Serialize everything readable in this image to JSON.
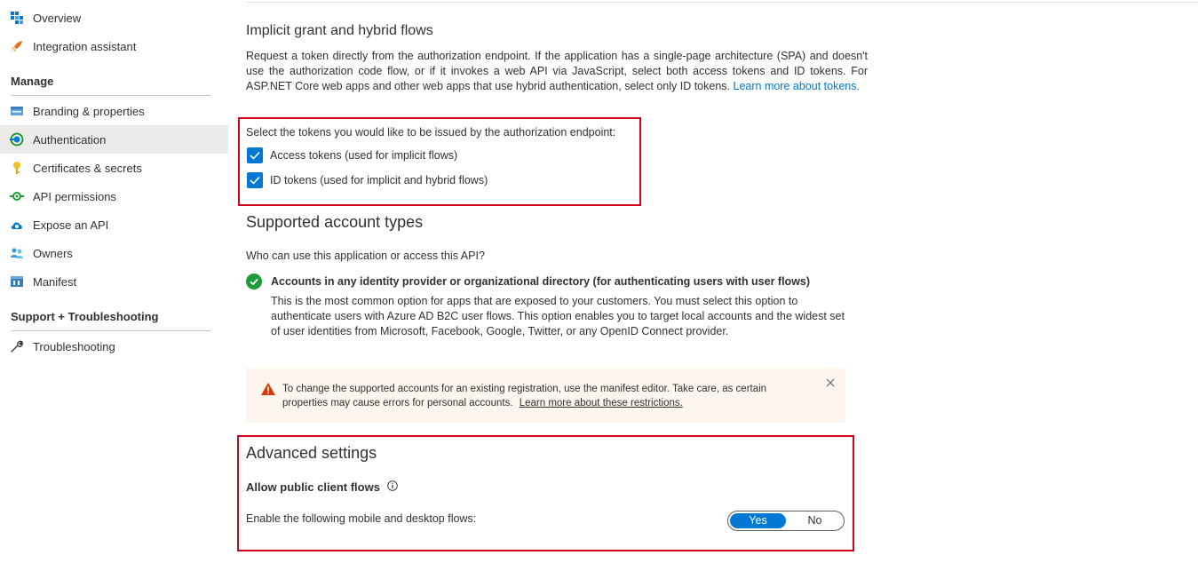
{
  "sidebar": {
    "top_items": [
      {
        "label": "Overview",
        "icon": "overview-grid-icon"
      },
      {
        "label": "Integration assistant",
        "icon": "rocket-icon"
      }
    ],
    "manage_header": "Manage",
    "manage_items": [
      {
        "label": "Branding & properties",
        "icon": "branding-icon"
      },
      {
        "label": "Authentication",
        "icon": "authentication-icon",
        "active": true
      },
      {
        "label": "Certificates & secrets",
        "icon": "key-icon"
      },
      {
        "label": "API permissions",
        "icon": "api-permissions-icon"
      },
      {
        "label": "Expose an API",
        "icon": "cloud-icon"
      },
      {
        "label": "Owners",
        "icon": "owners-icon"
      },
      {
        "label": "Manifest",
        "icon": "manifest-icon"
      }
    ],
    "support_header": "Support + Troubleshooting",
    "support_items": [
      {
        "label": "Troubleshooting",
        "icon": "wrench-icon"
      }
    ]
  },
  "implicit": {
    "title": "Implicit grant and hybrid flows",
    "description": "Request a token directly from the authorization endpoint. If the application has a single-page architecture (SPA) and doesn't use the authorization code flow, or if it invokes a web API via JavaScript, select both access tokens and ID tokens. For ASP.NET Core web apps and other web apps that use hybrid authentication, select only ID tokens.",
    "learn_more": "Learn more about tokens.",
    "select_prompt": "Select the tokens you would like to be issued by the authorization endpoint:",
    "access_tokens_label": "Access tokens (used for implicit flows)",
    "access_tokens_checked": true,
    "id_tokens_label": "ID tokens (used for implicit and hybrid flows)",
    "id_tokens_checked": true
  },
  "account_types": {
    "title": "Supported account types",
    "question": "Who can use this application or access this API?",
    "option_title": "Accounts in any identity provider or organizational directory (for authenticating users with user flows)",
    "option_description": "This is the most common option for apps that are exposed to your customers. You must select this option to authenticate users with Azure AD B2C user flows. This option enables you to target local accounts and the widest set of user identities from Microsoft, Facebook, Google, Twitter, or any OpenID Connect provider."
  },
  "warning": {
    "text": "To change the supported accounts for an existing registration, use the manifest editor. Take care, as certain properties may cause errors for personal accounts.",
    "link": "Learn more about these restrictions."
  },
  "advanced": {
    "title": "Advanced settings",
    "public_client_label": "Allow public client flows",
    "flows_label": "Enable the following mobile and desktop flows:",
    "toggle_yes": "Yes",
    "toggle_no": "No",
    "selected": "Yes"
  },
  "colors": {
    "accent": "#0078d4",
    "highlight_box": "#d0021b",
    "success": "#1f9b3a",
    "warning": "#d83b01"
  }
}
